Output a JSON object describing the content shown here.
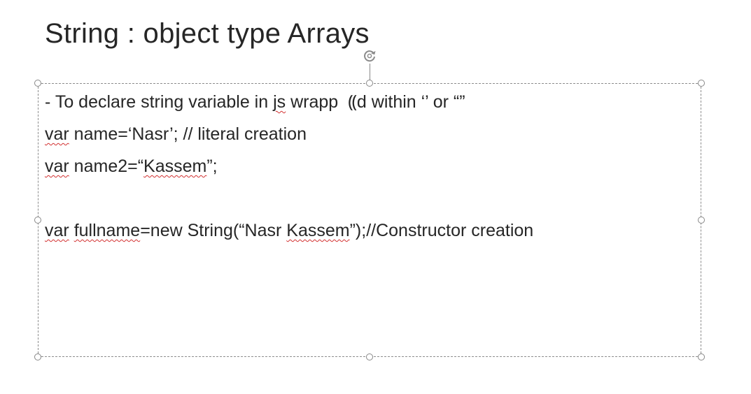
{
  "slide": {
    "title": "String : object type Arrays",
    "content": {
      "line1": {
        "prefix": "- To declare string variable in ",
        "squiggle": "js",
        "middle": " wrapp",
        "cursor_glyph": "⸨d",
        "suffix": " within ‘’ or “”"
      },
      "line2": {
        "squiggle": "var",
        "rest": " name=‘Nasr’; // literal creation"
      },
      "line3": {
        "squiggle": "var",
        "mid": " name2=“",
        "squiggle2": "Kassem",
        "rest": "”;"
      },
      "line5": {
        "squiggle": "var",
        "space": " ",
        "squiggle2": "fullname",
        "mid": "=new String(“Nasr ",
        "squiggle3": "Kassem",
        "rest": "”);//Constructor creation"
      }
    }
  },
  "colors": {
    "text": "#262626",
    "spellcheck": "#d23030",
    "selection_border": "#8c8c8c"
  },
  "icons": {
    "rotate": "rotate-handle-icon",
    "resize": "resize-handle"
  }
}
